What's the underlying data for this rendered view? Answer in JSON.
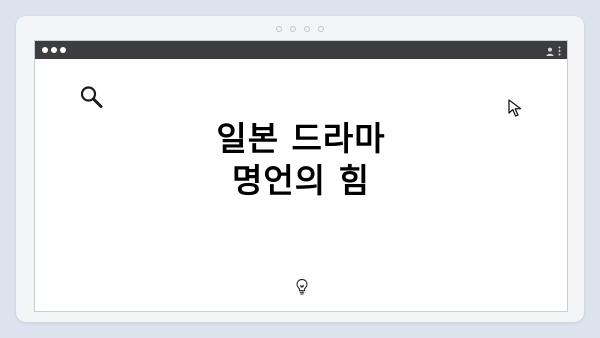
{
  "headline": {
    "line1": "일본 드라마",
    "line2": "명언의 힘"
  },
  "icons": {
    "search": "search-icon",
    "cursor": "cursor-arrow-icon",
    "bulb": "lightbulb-icon",
    "user": "user-icon",
    "menu": "kebab-menu-icon"
  },
  "colors": {
    "background": "#dbe4ee",
    "frame": "#f3f5f7",
    "titlebar": "#3d3d3f",
    "text": "#000000"
  }
}
